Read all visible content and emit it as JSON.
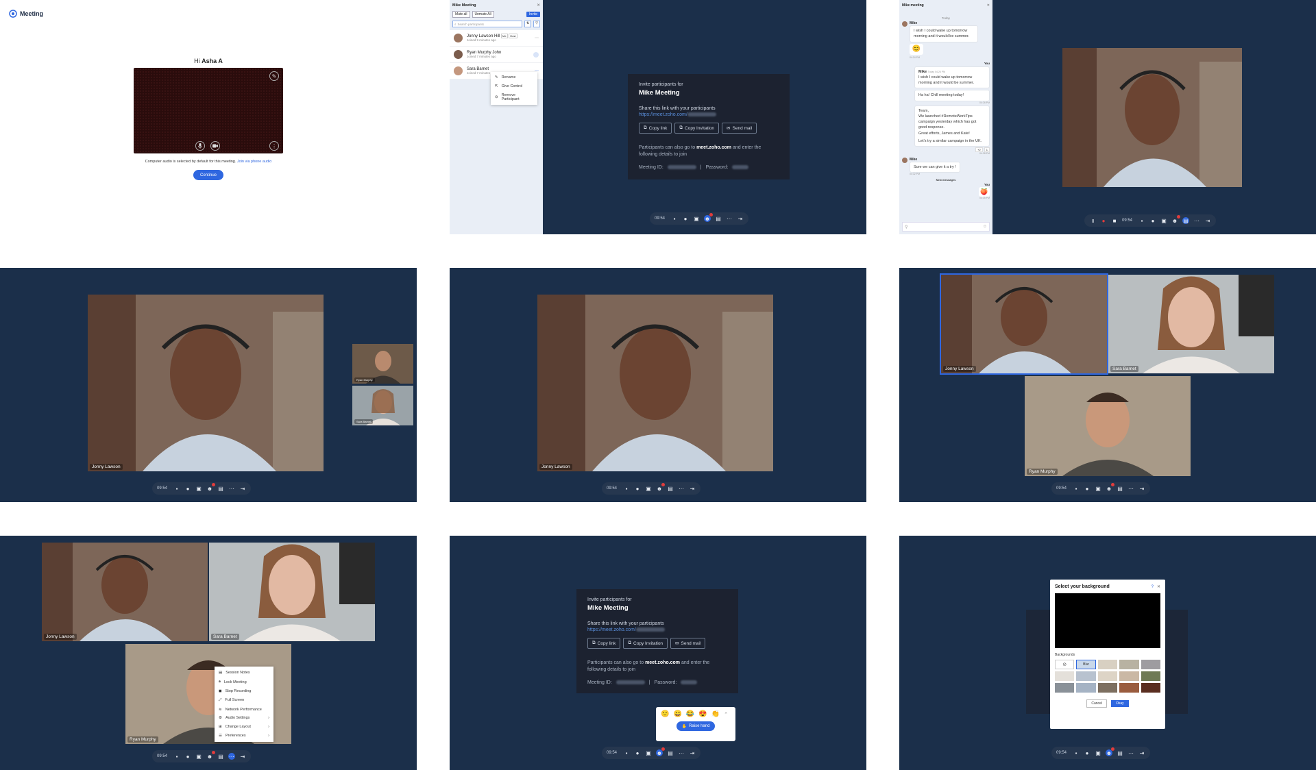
{
  "prejoin": {
    "brand": "Meeting",
    "greeting_prefix": "Hi",
    "user_name": "Asha A",
    "audio_note": "Computer audio is selected by default for this meeting.",
    "phone_link": "Join via phone audio",
    "continue_label": "Continue"
  },
  "participants": {
    "title": "Mike Meeting",
    "mute_all": "Mute all",
    "unmute_all": "Unmute All",
    "invite": "Invite",
    "search_placeholder": "Search participants",
    "list": [
      {
        "name": "Jonny Lawson Hill",
        "sub": "Joined 9 minutes ago",
        "tags": [
          "Me",
          "Host"
        ]
      },
      {
        "name": "Ryan Murphy John",
        "sub": "Joined 7 minutes ago"
      },
      {
        "name": "Sara Barnet",
        "sub": "Joined 7 minutes ago"
      }
    ],
    "menu": [
      "Rename",
      "Give Control",
      "Remove Participant"
    ]
  },
  "invite": {
    "heading": "Invite participants for",
    "meeting": "Mike Meeting",
    "share": "Share this link with your participants",
    "link": "https://meet.zoho.com/",
    "copy_link": "Copy link",
    "copy_invitation": "Copy Invitation",
    "send_mail": "Send mail",
    "also_prefix": "Participants can also go to ",
    "also_site": "meet.zoho.com",
    "also_suffix": " and enter the following details to join",
    "meeting_id": "Meeting ID:",
    "password": "Password:"
  },
  "chat": {
    "title": "Mike meeting",
    "today": "Today",
    "m1_sender": "Mike",
    "m1_text": "I wish I could wake up tomorrow morning and it would be summer.",
    "m1_time": "04:24 PM",
    "you": "You",
    "quote_sender": "Mike",
    "quote_time": "Today 04:24 PM",
    "quote_text": "I wish I could wake up tomorrow morning and it would be summer.",
    "reply1": "Ha ha! Chill meeting today!",
    "reply1_time": "04:26 PM",
    "long_msg": [
      "Team,",
      "We launched #RemoteWorkTips campaign yesterday which has got good response.",
      "Great efforts, James and Kate!",
      "",
      "Let's try a similar campaign in the UK."
    ],
    "long_time": "04:28 PM",
    "reactions": [
      "+2",
      "1"
    ],
    "m2_sender": "Mike",
    "m2_text": "Sure we can give it a try !",
    "m2_time": "04:32 PM",
    "new_messages": "New messages",
    "you2": "You",
    "you2_time": "04:35 PM"
  },
  "toolbar": {
    "time": "09:54"
  },
  "names": {
    "jonny": "Jonny Lawson",
    "ryan": "Ryan Murphy",
    "sara": "Sara Barnet"
  },
  "more_menu": [
    "Session Notes",
    "Lock Meeting",
    "Stop Recording",
    "Full Screen",
    "Network Performance",
    "Audio Settings",
    "Change Layout",
    "Preferences"
  ],
  "reactions": {
    "raise_hand": "Raise hand"
  },
  "background": {
    "title": "Select your background",
    "section": "Backgrounds",
    "blur": "Blur",
    "cancel": "Cancel",
    "okay": "Okay"
  },
  "colors": {
    "navy": "#1b2f4a",
    "accent": "#2f67e0",
    "dark_panel": "#1c2230"
  }
}
